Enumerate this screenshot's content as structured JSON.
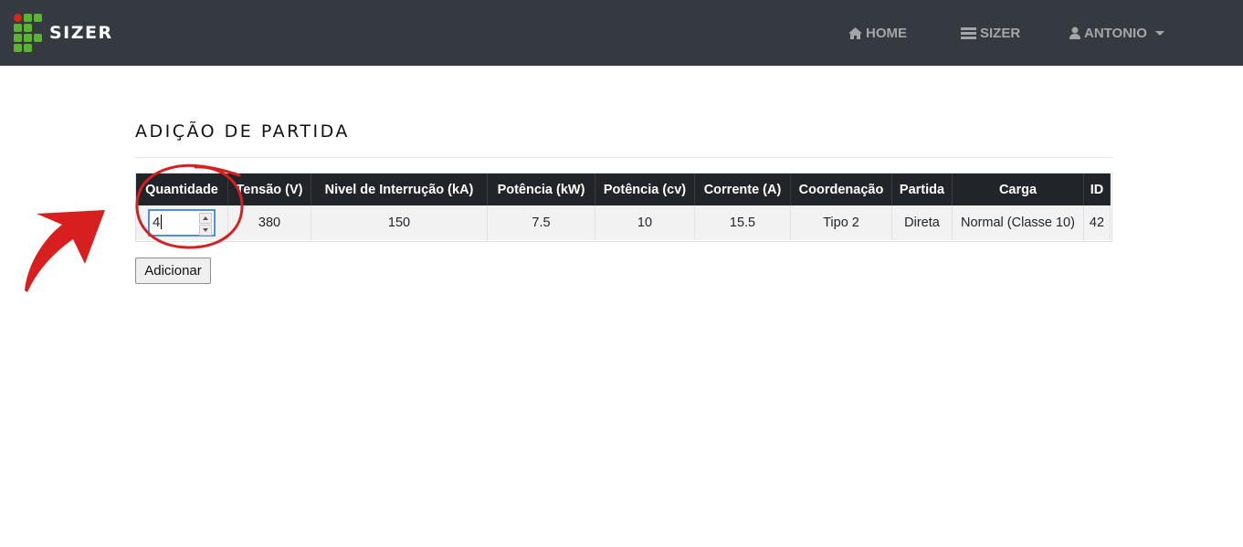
{
  "navbar": {
    "brand": "SIZER",
    "items": [
      {
        "label": "HOME",
        "icon": "home-icon"
      },
      {
        "label": "SIZER",
        "icon": "list-icon"
      },
      {
        "label": "ANTONIO",
        "icon": "user-icon",
        "dropdown": true
      }
    ]
  },
  "page": {
    "title": "ADIÇÃO DE PARTIDA"
  },
  "table": {
    "headers": [
      "Quantidade",
      "Tensão (V)",
      "Nivel de Interrução (kA)",
      "Potência (kW)",
      "Potência (cv)",
      "Corrente (A)",
      "Coordenação",
      "Partida",
      "Carga",
      "ID"
    ],
    "row": {
      "quantidade": "4",
      "tensao": "380",
      "nivel_interrupcao": "150",
      "potencia_kw": "7.5",
      "potencia_cv": "10",
      "corrente": "15.5",
      "coordenacao": "Tipo 2",
      "partida": "Direta",
      "carga": "Normal (Classe 10)",
      "id": "42"
    }
  },
  "actions": {
    "add_label": "Adicionar"
  },
  "colors": {
    "navbar_bg": "#343a40",
    "logo_green": "#5bb531",
    "logo_red": "#d8261c",
    "table_header_bg": "#212529",
    "annotation_red": "#d71f1f"
  }
}
